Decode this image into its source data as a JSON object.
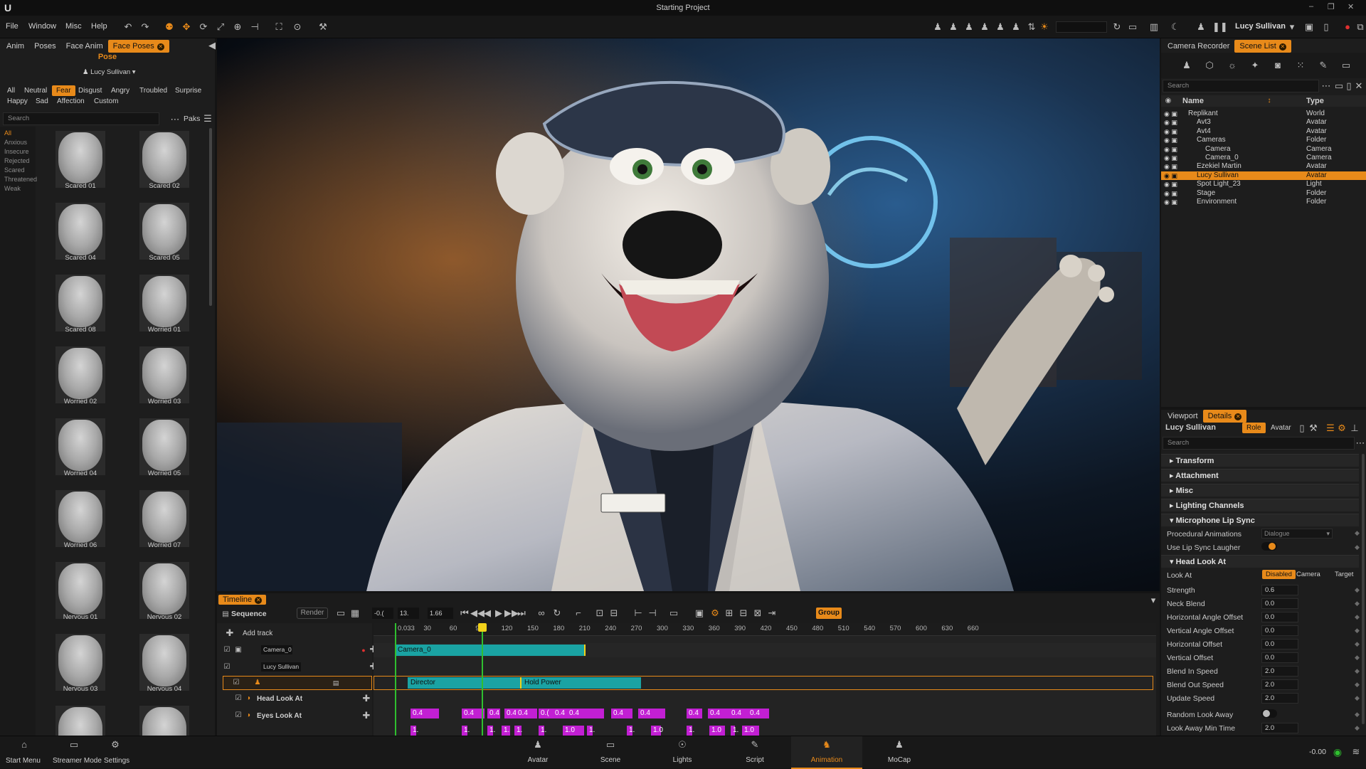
{
  "app": {
    "title": "Starting Project",
    "user": "Lucy Sullivan"
  },
  "menu": [
    "File",
    "Window",
    "Misc",
    "Help"
  ],
  "left": {
    "tabs": [
      "Anim",
      "Poses",
      "Face Anim",
      "Face Poses"
    ],
    "heading": "Pose",
    "avatar": "Lucy Sullivan",
    "filters_row1": [
      "All",
      "Neutral",
      "Fear",
      "Disgust",
      "Angry",
      "Troubled",
      "Surprise"
    ],
    "filters_row2": [
      "Happy",
      "Sad",
      "Affection",
      "Custom"
    ],
    "search_placeholder": "Search",
    "paks": "Paks",
    "categories": [
      "All",
      "Anxious",
      "Insecure",
      "Rejected",
      "Scared",
      "Threatened",
      "Weak"
    ],
    "poses": [
      "Scared 01",
      "Scared 02",
      "Scared 04",
      "Scared 05",
      "Scared 08",
      "Worried 01",
      "Worried 02",
      "Worried 03",
      "Worried 04",
      "Worried 05",
      "Worried 06",
      "Worried 07",
      "Nervous 01",
      "Nervous 02",
      "Nervous 03",
      "Nervous 04",
      "",
      ""
    ]
  },
  "timeline": {
    "tab": "Timeline",
    "sequence": "Sequence",
    "render": "Render",
    "field1": "-0.(",
    "field2": "13.",
    "field3": "1.66",
    "group": "Group",
    "add_track": "Add track",
    "ruler": [
      "0.033",
      "30",
      "60",
      "90",
      "120",
      "150",
      "180",
      "210",
      "240",
      "270",
      "300",
      "330",
      "360",
      "390",
      "420",
      "450",
      "480",
      "510",
      "540",
      "570",
      "600",
      "630",
      "660"
    ],
    "tracks": {
      "camera": "Camera_0",
      "avatar": "Lucy Sullivan",
      "head": "Head Look At",
      "eyes": "Eyes Look At"
    },
    "clips": {
      "camera": "Camera_0",
      "director": "Director",
      "hold": "Hold Power"
    },
    "head_keys": [
      "0.4",
      "0.4",
      "0.4",
      "0.4",
      "0.4",
      "0.(",
      "0.4",
      "0.4",
      "0.4",
      "0.4",
      "0.4",
      "0.4",
      "0.4",
      "0.4"
    ],
    "eye_keys": [
      "1.",
      "1.",
      "1.",
      "1.",
      "1.",
      "1.",
      "1.0",
      "1.",
      "1.",
      "1.0",
      "1.",
      "1.0",
      "1.",
      "1.0"
    ]
  },
  "right": {
    "tabs": [
      "Camera Recorder",
      "Scene List"
    ],
    "search": "Search",
    "col_name": "Name",
    "col_type": "Type",
    "scene": [
      {
        "name": "Replikant",
        "type": "World"
      },
      {
        "name": "Avt3",
        "type": "Avatar"
      },
      {
        "name": "Avt4",
        "type": "Avatar"
      },
      {
        "name": "Cameras",
        "type": "Folder"
      },
      {
        "name": "Camera",
        "type": "Camera"
      },
      {
        "name": "Camera_0",
        "type": "Camera"
      },
      {
        "name": "Ezekiel Martin",
        "type": "Avatar"
      },
      {
        "name": "Lucy Sullivan",
        "type": "Avatar"
      },
      {
        "name": "Spot Light_23",
        "type": "Light"
      },
      {
        "name": "Stage",
        "type": "Folder"
      },
      {
        "name": "Environment",
        "type": "Folder"
      }
    ],
    "details_tabs": [
      "Viewport",
      "Details"
    ],
    "details_title": "Lucy Sullivan",
    "role": "Role",
    "avatar_tab": "Avatar",
    "details_search": "Search",
    "sections": [
      "Transform",
      "Attachment",
      "Misc",
      "Lighting Channels",
      "Microphone Lip Sync",
      "Head Look At"
    ],
    "props": {
      "proc_anim": "Procedural Animations",
      "proc_val": "Dialogue",
      "laughter": "Use Lip Sync Laugher",
      "look_at": "Look At",
      "look_opts": [
        "Disabled",
        "Camera",
        "Target"
      ],
      "fields": [
        {
          "label": "Strength",
          "value": "0.6"
        },
        {
          "label": "Neck Blend",
          "value": "0.0"
        },
        {
          "label": "Horizontal Angle Offset",
          "value": "0.0"
        },
        {
          "label": "Vertical Angle Offset",
          "value": "0.0"
        },
        {
          "label": "Horizontal Offset",
          "value": "0.0"
        },
        {
          "label": "Vertical Offset",
          "value": "0.0"
        },
        {
          "label": "Blend In Speed",
          "value": "2.0"
        },
        {
          "label": "Blend Out Speed",
          "value": "2.0"
        },
        {
          "label": "Update Speed",
          "value": "2.0"
        }
      ],
      "random": "Random Look Away",
      "min_time": "Look Away Min Time",
      "min_val": "2.0"
    }
  },
  "bottom": {
    "left": [
      "Start Menu",
      "Streamer Mode",
      "Settings"
    ],
    "center": [
      "Avatar",
      "Scene",
      "Lights",
      "Script",
      "Animation",
      "MoCap"
    ],
    "readout": "-0.00"
  },
  "colors": {
    "accent": "#e88a1a",
    "key": "#c21fd3",
    "clip": "#1aa3a3",
    "playhead": "#f2d21a"
  }
}
